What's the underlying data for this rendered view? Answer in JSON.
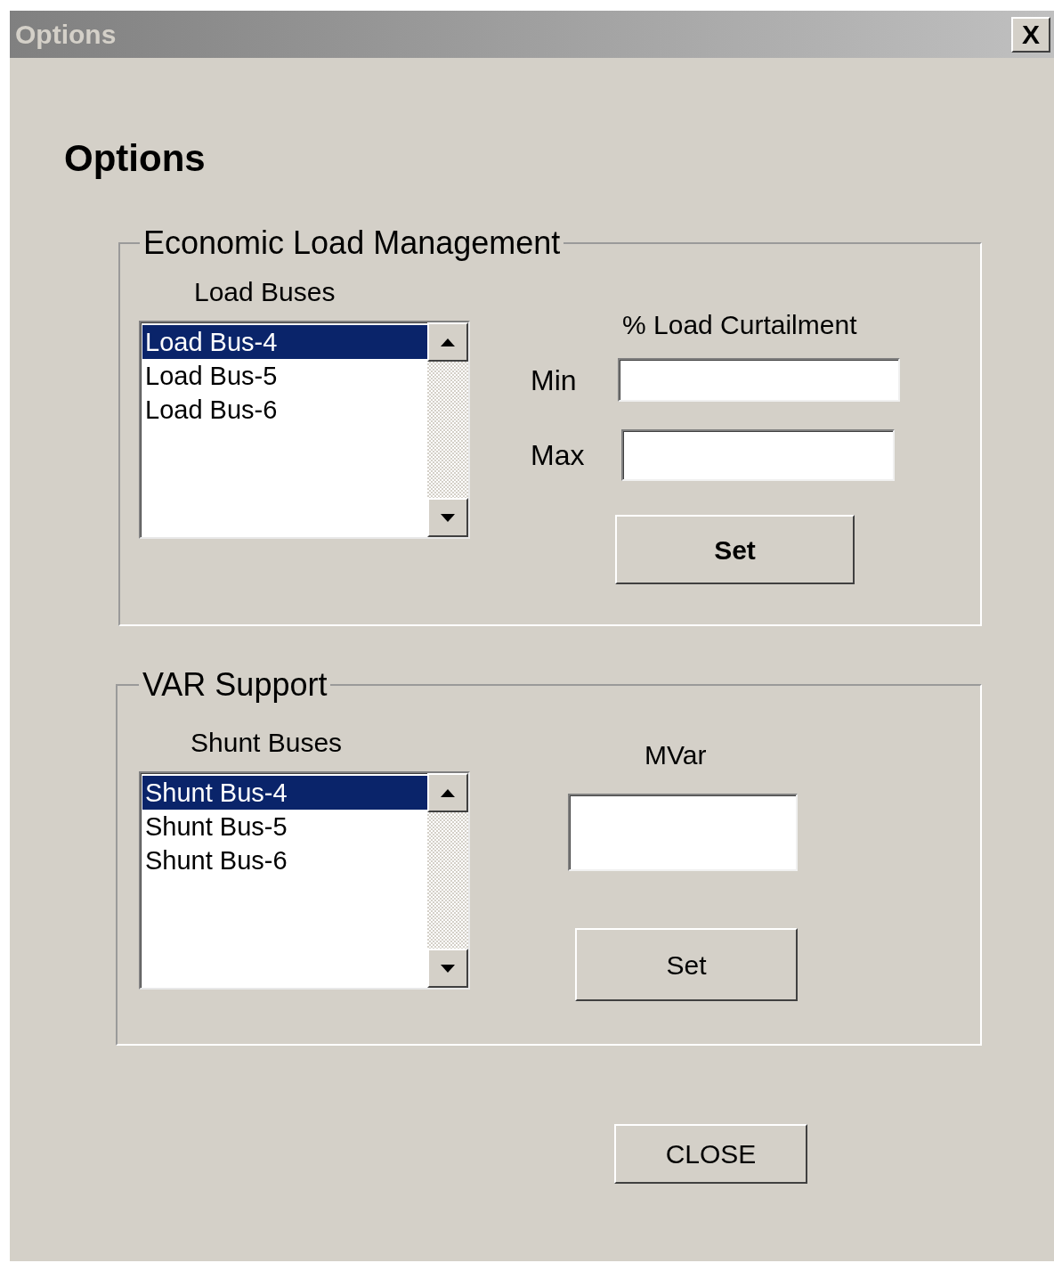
{
  "window": {
    "title": "Options",
    "close": "X"
  },
  "heading": "Options",
  "load_management": {
    "title": "Economic Load Management",
    "list_label": "Load Buses",
    "items": [
      {
        "label": "Load Bus-4",
        "selected": true
      },
      {
        "label": "Load Bus-5",
        "selected": false
      },
      {
        "label": "Load Bus-6",
        "selected": false
      }
    ],
    "curtailment_label": "% Load Curtailment",
    "min_label": "Min",
    "max_label": "Max",
    "set_button": "Set"
  },
  "var_support": {
    "title": "VAR Support",
    "list_label": "Shunt Buses",
    "items": [
      {
        "label": "Shunt Bus-4",
        "selected": true
      },
      {
        "label": "Shunt Bus-5",
        "selected": false
      },
      {
        "label": "Shunt Bus-6",
        "selected": false
      }
    ],
    "mvar_label": "MVar",
    "set_button": "Set"
  },
  "close_button": "CLOSE"
}
